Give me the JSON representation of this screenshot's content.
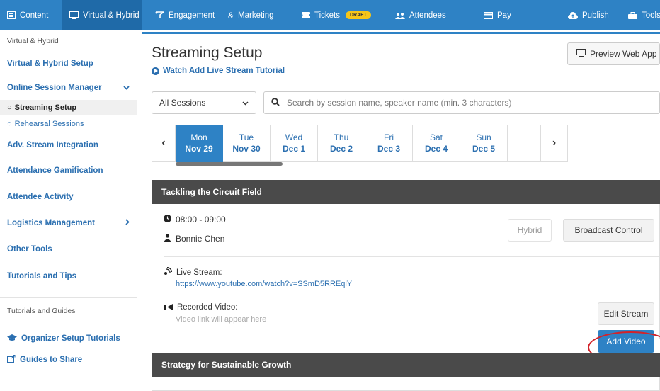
{
  "topnav": {
    "tabs": [
      {
        "label": "Content",
        "icon": "content-icon"
      },
      {
        "label": "Virtual & Hybrid",
        "icon": "monitor-icon",
        "active": true
      },
      {
        "label": "Engagement",
        "icon": "engagement-icon"
      },
      {
        "label": "Marketing",
        "icon": "marketing-icon"
      },
      {
        "label": "Tickets",
        "icon": "ticket-icon",
        "badge": "DRAFT"
      },
      {
        "label": "Attendees",
        "icon": "users-icon"
      },
      {
        "label": "Pay",
        "icon": "card-icon"
      },
      {
        "label": "Publish",
        "icon": "cloud-upload-icon"
      },
      {
        "label": "Tools",
        "icon": "toolbox-icon"
      }
    ]
  },
  "sidebar": {
    "section_title": "Virtual & Hybrid",
    "items": [
      "Virtual & Hybrid Setup",
      "Online Session Manager",
      "Streaming Setup",
      "Rehearsal Sessions",
      "Adv. Stream Integration",
      "Attendance Gamification",
      "Attendee Activity",
      "Logistics Management",
      "Other Tools",
      "Tutorials and Tips"
    ],
    "guides_title": "Tutorials and Guides",
    "guides": [
      "Organizer Setup Tutorials",
      "Guides to Share"
    ]
  },
  "main": {
    "title": "Streaming Setup",
    "tutorial_link": "Watch Add Live Stream Tutorial",
    "preview_button": "Preview Web App",
    "session_filter": "All Sessions",
    "search_placeholder": "Search by session name, speaker name (min. 3 characters)",
    "days": [
      {
        "day": "Mon",
        "date": "Nov 29",
        "active": true
      },
      {
        "day": "Tue",
        "date": "Nov 30"
      },
      {
        "day": "Wed",
        "date": "Dec 1"
      },
      {
        "day": "Thu",
        "date": "Dec 2"
      },
      {
        "day": "Fri",
        "date": "Dec 3"
      },
      {
        "day": "Sat",
        "date": "Dec 4"
      },
      {
        "day": "Sun",
        "date": "Dec 5"
      }
    ],
    "sessions": [
      {
        "title": "Tackling the Circuit Field",
        "time": "08:00 - 09:00",
        "speaker": "Bonnie Chen",
        "hybrid_label": "Hybrid",
        "broadcast_label": "Broadcast Control",
        "live_stream_label": "Live Stream:",
        "live_stream_url": "https://www.youtube.com/watch?v=SSmD5RREqlY",
        "edit_stream_label": "Edit Stream",
        "recorded_video_label": "Recorded Video:",
        "recorded_video_placeholder": "Video link will appear here",
        "add_video_label": "Add Video"
      },
      {
        "title": "Strategy for Sustainable Growth"
      }
    ]
  },
  "colors": {
    "brand_blue": "#2e82c5",
    "link_blue": "#2b6fb0",
    "session_header": "#4a4a4a",
    "highlight_red": "#d2232a",
    "draft_badge": "#f5c518"
  }
}
